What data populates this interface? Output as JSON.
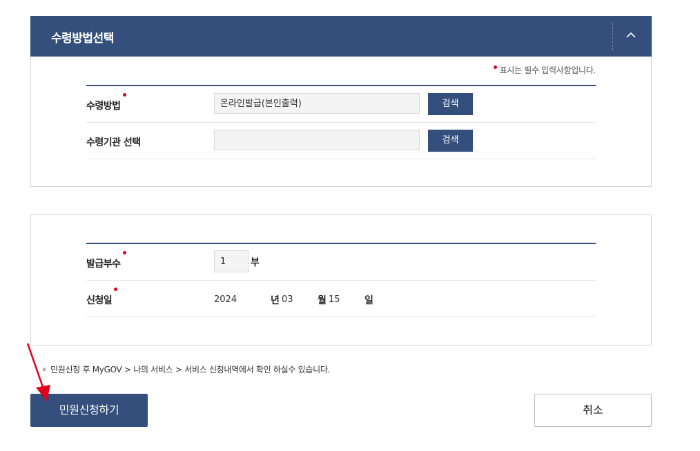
{
  "receipt_section": {
    "title": "수령방법선택",
    "required_note": "표시는 필수 입력사항입니다.",
    "rows": [
      {
        "label": "수령방법",
        "required": true,
        "value": "온라인발급(본인출력)",
        "button": "검색"
      },
      {
        "label": "수령기관 선택",
        "required": false,
        "value": "",
        "button": "검색"
      }
    ]
  },
  "issue_section": {
    "copies": {
      "label": "발급부수",
      "value": "1",
      "unit": "부"
    },
    "date": {
      "label": "신청일",
      "year": "2024",
      "year_unit": "년",
      "month": "03",
      "month_unit": "월",
      "day": "15",
      "day_unit": "일"
    }
  },
  "info_text": "민원신청 후 MyGOV > 나의 서비스 > 서비스 신청내역에서 확인 하실수 있습니다.",
  "actions": {
    "submit": "민원신청하기",
    "cancel": "취소"
  },
  "colors": {
    "primary": "#344f7b",
    "required_dot": "#e0001b",
    "annotation_arrow": "#e0001b"
  },
  "icons": {
    "collapse": "chevron-up-icon"
  }
}
